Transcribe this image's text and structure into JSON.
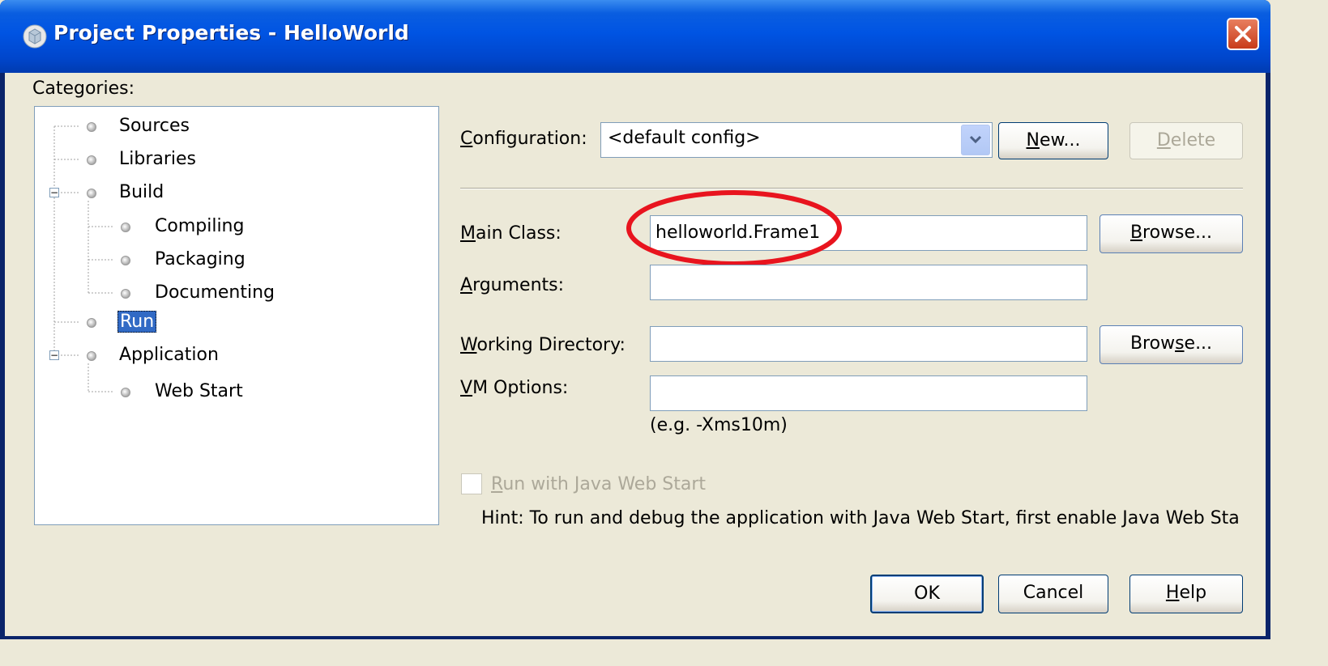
{
  "window": {
    "title": "Project Properties - HelloWorld",
    "close_icon": "close-icon",
    "accent_color": "#0054e3"
  },
  "categories": {
    "label": "Categories:",
    "items": [
      {
        "label": "Sources",
        "level": 0
      },
      {
        "label": "Libraries",
        "level": 0
      },
      {
        "label": "Build",
        "level": 0,
        "expanded": true
      },
      {
        "label": "Compiling",
        "level": 1
      },
      {
        "label": "Packaging",
        "level": 1
      },
      {
        "label": "Documenting",
        "level": 1
      },
      {
        "label": "Run",
        "level": 0,
        "selected": true
      },
      {
        "label": "Application",
        "level": 0,
        "expanded": true
      },
      {
        "label": "Web Start",
        "level": 1
      }
    ]
  },
  "configuration": {
    "label_mnemonic": "C",
    "label_rest": "onfiguration:",
    "value": "<default config>",
    "new_mnemonic": "N",
    "new_rest": "ew...",
    "delete_mnemonic": "D",
    "delete_rest": "elete"
  },
  "main_class": {
    "label_mnemonic": "M",
    "label_rest": "ain Class:",
    "value": "helloworld.Frame1",
    "browse_mnemonic": "B",
    "browse_rest": "rowse..."
  },
  "arguments": {
    "label_mnemonic": "A",
    "label_rest": "rguments:",
    "value": ""
  },
  "working_directory": {
    "label_mnemonic": "W",
    "label_rest": "orking Directory:",
    "value": "",
    "browse_pre": "Brow",
    "browse_mnemonic": "s",
    "browse_rest": "e..."
  },
  "vm_options": {
    "label_mnemonic": "V",
    "label_rest": "M Options:",
    "value": "",
    "example": "(e.g. -Xms10m)"
  },
  "web_start": {
    "checkbox_mnemonic": "R",
    "checkbox_rest": "un with Java Web Start",
    "checked": false,
    "hint": "Hint: To run and debug the application with Java Web Start, first enable Java Web Sta"
  },
  "footer": {
    "ok": "OK",
    "cancel": "Cancel",
    "help_mnemonic": "H",
    "help_rest": "elp"
  },
  "annotation": {
    "color": "#e8141e"
  }
}
